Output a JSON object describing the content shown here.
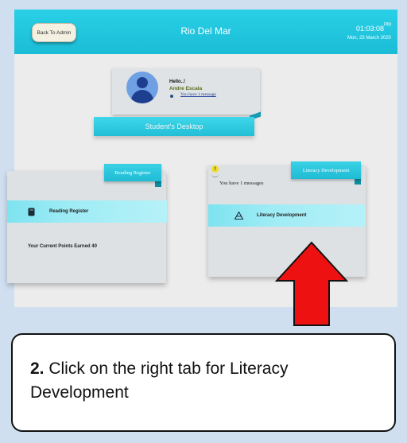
{
  "app": {
    "back_label": "Back To Admin",
    "title": "Rio Del Mar",
    "time": "01:03:08",
    "ampm": "PM",
    "date": "Mon, 23 March 2020"
  },
  "profile": {
    "greeting": "Hello..!",
    "name": "Andre Escala",
    "message_link": "You have 1 message"
  },
  "desktop_ribbon": "Student's Desktop",
  "reading": {
    "tag": "Reading Register",
    "band_label": "Reading Register",
    "points": "Your Current Points Earned 40"
  },
  "literacy": {
    "tag": "Literacy Development",
    "badge": "!",
    "messages": "You have 1 messages",
    "band_label": "Literacy Development"
  },
  "instruction": {
    "step": "2.",
    "text": " Click on the right tab for Literacy Development"
  },
  "colors": {
    "accent_cyan": "#1fbcd4",
    "arrow_red": "#ee1111",
    "background": "#cfdff0"
  },
  "icons": {
    "reading": "book-icon",
    "literacy": "pyramid-icon",
    "alert": "alert-badge-icon",
    "arrow": "up-arrow-icon"
  }
}
